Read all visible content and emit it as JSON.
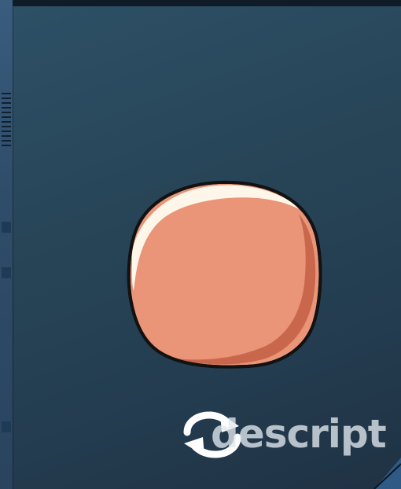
{
  "watermark": {
    "brand_text": "descript",
    "logo_icon": "descript-sync-logo-icon"
  },
  "scene": {
    "object_icon": "peach-blob-icon",
    "background_color": "#284659",
    "object_color": "#ea9478"
  }
}
